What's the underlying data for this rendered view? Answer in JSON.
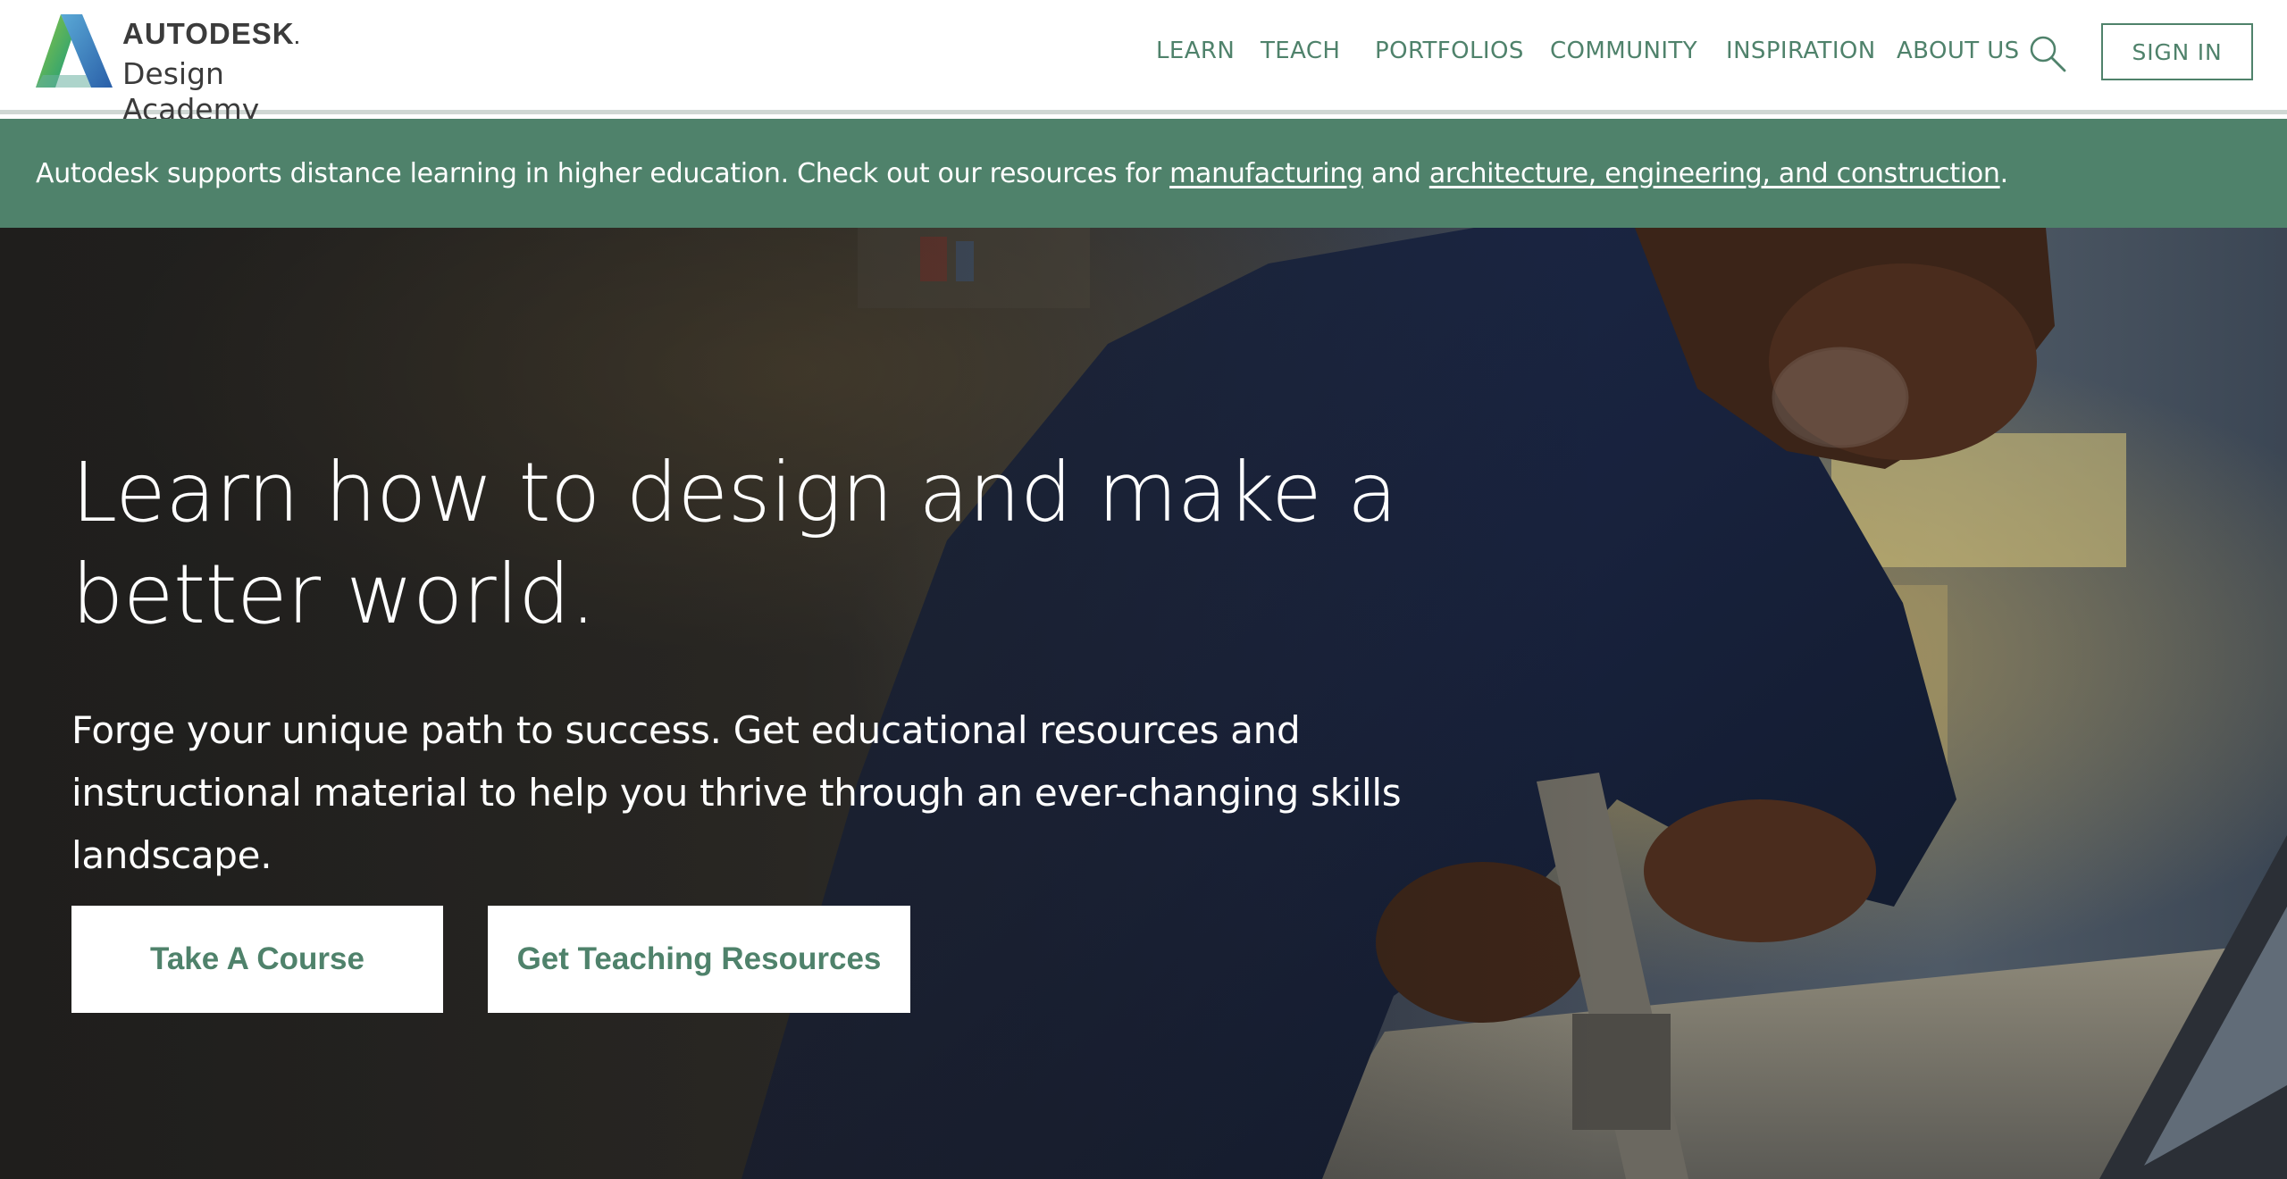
{
  "header": {
    "logo": {
      "brand": "AUTODESK",
      "brand_dot": ".",
      "product": "Design Academy"
    },
    "nav": [
      {
        "label": "LEARN"
      },
      {
        "label": "TEACH"
      },
      {
        "label": "PORTFOLIOS"
      },
      {
        "label": "COMMUNITY"
      },
      {
        "label": "INSPIRATION"
      },
      {
        "label": "ABOUT US"
      }
    ],
    "search_icon": "search-icon",
    "sign_in": "SIGN IN"
  },
  "banner": {
    "text_before": "Autodesk supports distance learning in higher education. Check out our resources for ",
    "link_manufacturing": "manufacturing",
    "text_and": " and ",
    "link_aec": "architecture, engineering, and construction",
    "text_after": "."
  },
  "hero": {
    "title": "Learn how to design and make a better world.",
    "subtitle": "Forge your unique path to success. Get educational resources and instructional material to help you thrive through an ever-changing skills landscape.",
    "buttons": {
      "course": "Take A Course",
      "teach": "Get Teaching Resources"
    }
  },
  "colors": {
    "accent": "#4f826b",
    "banner_bg": "#4f826b",
    "text_dark": "#3b3b3b",
    "white": "#ffffff"
  }
}
